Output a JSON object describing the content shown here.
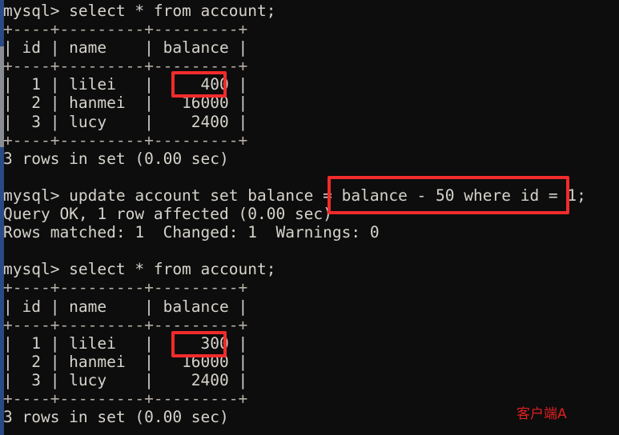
{
  "terminal": {
    "background_color": "#0d0d0d",
    "text_color": "#d6d3cc",
    "highlight_color": "#f22b2b",
    "annotation_color": "#e02020",
    "scrollbar": {
      "track_color": "#2a4a86",
      "thumb_color": "#8a8d94"
    },
    "lines": [
      "mysql> select * from account;",
      "+----+---------+---------+",
      "| id | name    | balance |",
      "+----+---------+---------+",
      "|  1 | lilei   |     400 |",
      "|  2 | hanmei  |   16000 |",
      "|  3 | lucy    |    2400 |",
      "+----+---------+---------+",
      "3 rows in set (0.00 sec)",
      "",
      "mysql> update account set balance = balance - 50 where id = 1;",
      "Query OK, 1 row affected (0.00 sec)",
      "Rows matched: 1  Changed: 1  Warnings: 0",
      "",
      "mysql> select * from account;",
      "+----+---------+---------+",
      "| id | name    | balance |",
      "+----+---------+---------+",
      "|  1 | lilei   |     300 |",
      "|  2 | hanmei  |   16000 |",
      "|  3 | lucy    |    2400 |",
      "+----+---------+---------+",
      "3 rows in set (0.00 sec)"
    ]
  },
  "highlights": {
    "balance_before": "400",
    "balance_after": "300",
    "update_expression": "balance - 50 where id = 1"
  },
  "annotation": {
    "client_label": "客户端A"
  }
}
